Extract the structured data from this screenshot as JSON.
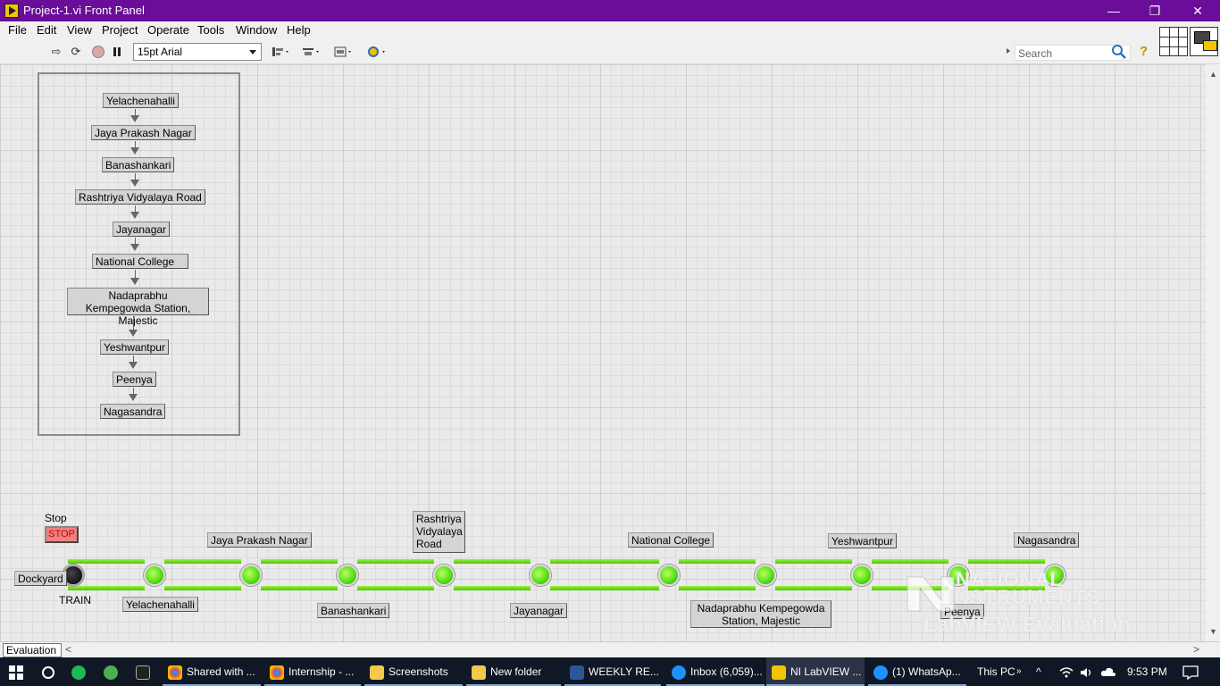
{
  "window": {
    "title": "Project-1.vi Front Panel",
    "minimize": "—",
    "restore": "❐",
    "close": "✕"
  },
  "menu": [
    "File",
    "Edit",
    "View",
    "Project",
    "Operate",
    "Tools",
    "Window",
    "Help"
  ],
  "toolbar": {
    "font": "15pt Arial",
    "search_placeholder": "Search"
  },
  "flow": {
    "stations": [
      "Yelachenahalli",
      "Jaya Prakash Nagar",
      "Banashankari",
      "Rashtriya Vidyalaya Road",
      "Jayanagar",
      "National College",
      "Nadaprabhu Kempegowda Station, Majestic",
      "Yeshwantpur",
      "Peenya",
      "Nagasandra"
    ]
  },
  "controls": {
    "stop_caption": "Stop",
    "stop_button": "STOP",
    "train_label": "TRAIN",
    "start_label": "Dockyard"
  },
  "track": {
    "top_labels": {
      "jp_nagar": "Jaya Prakash Nagar",
      "rv_road_1": "Rashtriya",
      "rv_road_2": "Vidyalaya",
      "rv_road_3": "Road",
      "national_college": "National College",
      "yeshwantpur": "Yeshwantpur",
      "nagasandra": "Nagasandra"
    },
    "bottom_labels": {
      "yelachenahalli": "Yelachenahalli",
      "banashankari": "Banashankari",
      "jayanagar": "Jayanagar",
      "majestic_1": "Nadaprabhu Kempegowda",
      "majestic_2": "Station, Majestic",
      "peenya": "Peenya"
    },
    "led_states": [
      "off",
      "on",
      "on",
      "on",
      "on",
      "on",
      "on",
      "on",
      "on",
      "on",
      "on"
    ]
  },
  "watermark": {
    "line1": "NATIONAL",
    "line2": "INSTRUMENTS",
    "line3": "LabVIEW Evaluation Software"
  },
  "status": {
    "evaluation": "Evaluation"
  },
  "taskbar": {
    "items": [
      "Shared with ...",
      "Internship - ...",
      "Screenshots",
      "New folder",
      "WEEKLY RE...",
      "Inbox (6,059)...",
      "NI LabVIEW ...",
      "(1) WhatsAp..."
    ],
    "this_pc": "This PC",
    "time": "9:53 PM"
  },
  "colors": {
    "titlebar": "#6a0d99",
    "led_on": "#5ae01a",
    "led_off": "#000000",
    "stop_button": "#f08080"
  }
}
